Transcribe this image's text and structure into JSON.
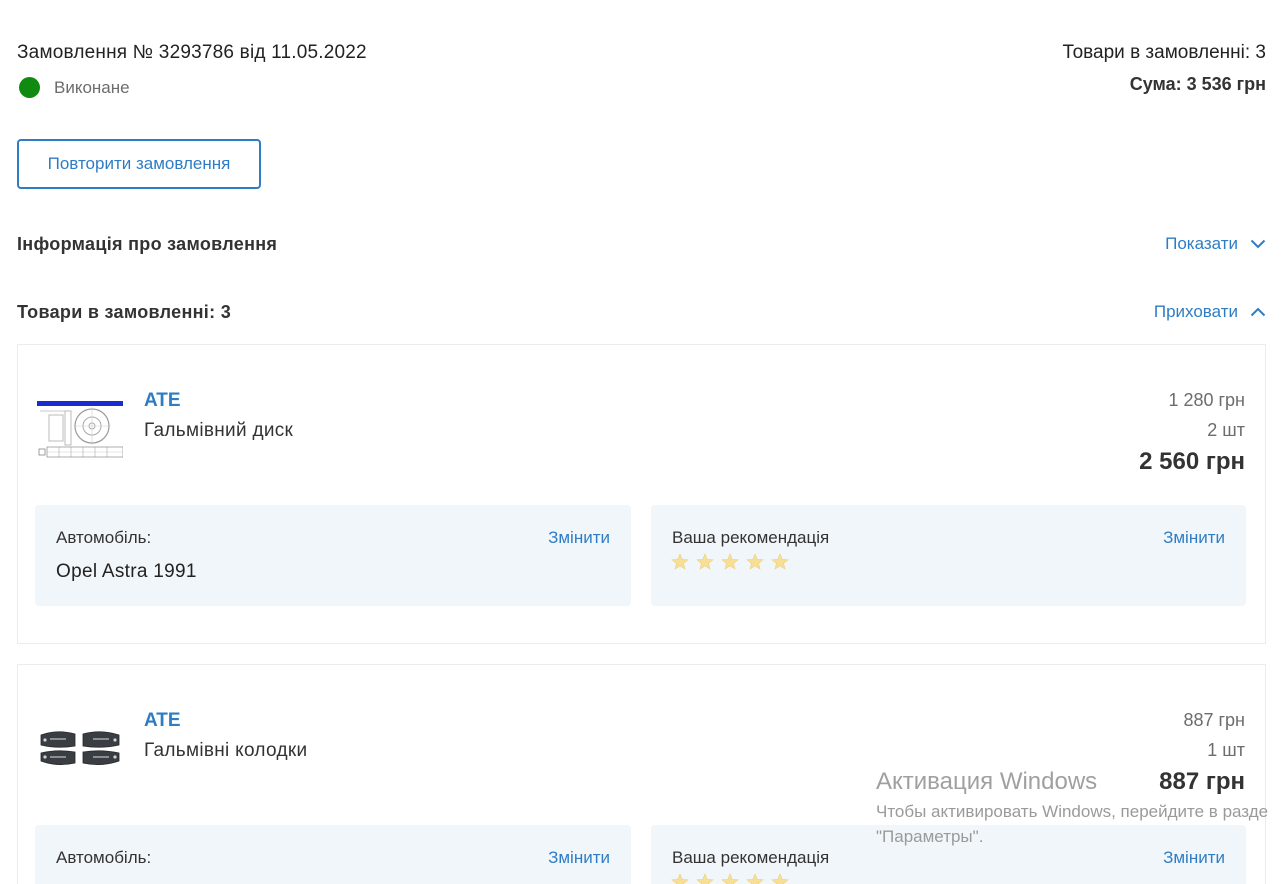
{
  "order": {
    "title": "Замовлення № 3293786 від 11.05.2022",
    "status": "Виконане",
    "status_color": "#118a11",
    "items_count_label": "Товари в замовленні: 3",
    "sum_label": "Сума: 3 536 грн",
    "repeat_button": "Повторити замовлення"
  },
  "info_section": {
    "title": "Інформація про замовлення",
    "toggle_label": "Показати",
    "toggle_icon": "chevron-down-icon"
  },
  "items_section": {
    "title": "Товари в замовленні: 3",
    "toggle_label": "Приховати",
    "toggle_icon": "chevron-up-icon"
  },
  "items": [
    {
      "brand": "ATE",
      "name": "Гальмівний диск",
      "image": "brake-disc-drawing",
      "unit_price": "1 280 грн",
      "qty": "2 шт",
      "total": "2 560 грн",
      "car_label": "Автомобіль:",
      "car_value": "Opel Astra 1991",
      "car_change": "Змінити",
      "rec_label": "Ваша рекомендація",
      "rec_change": "Змінити",
      "rating": 0,
      "rating_max": 5
    },
    {
      "brand": "ATE",
      "name": "Гальмівні колодки",
      "image": "brake-pads-photo",
      "unit_price": "887 грн",
      "qty": "1 шт",
      "total": "887 грн",
      "car_label": "Автомобіль:",
      "car_change": "Змінити",
      "rec_label": "Ваша рекомендація",
      "rec_change": "Змінити",
      "rating": 0,
      "rating_max": 5
    }
  ],
  "watermark": {
    "title": "Активация Windows",
    "line1": "Чтобы активировать Windows, перейдите в разде",
    "line2": "\"Параметры\"."
  },
  "colors": {
    "accent": "#2e7dc4",
    "panel_bg": "#f1f6fb",
    "star": "#f7df96"
  }
}
